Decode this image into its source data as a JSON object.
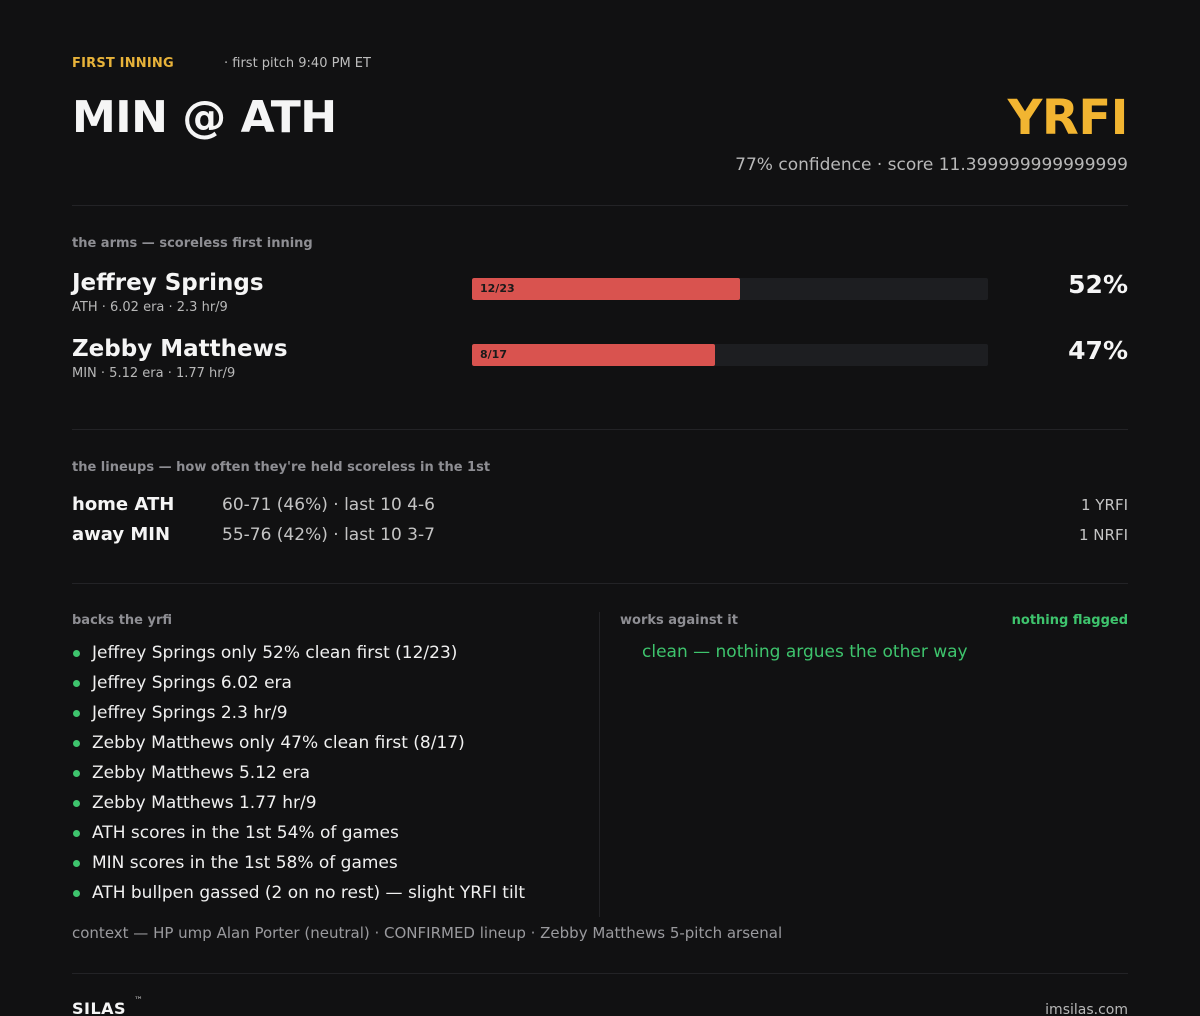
{
  "header": {
    "inning_tag": "FIRST INNING",
    "first_pitch": "· first pitch 9:40 PM ET",
    "matchup": "MIN @ ATH",
    "pick": "YRFI",
    "confidence_line": "77% confidence · score 11.399999999999999"
  },
  "arms": {
    "title": "the arms — scoreless first inning",
    "pitchers": [
      {
        "name": "Jeffrey Springs",
        "meta": "ATH · 6.02 era · 2.3 hr/9",
        "record": "12/23",
        "clean_fraction": 0.52,
        "pct_label": "52%"
      },
      {
        "name": "Zebby Matthews",
        "meta": "MIN · 5.12 era · 1.77 hr/9",
        "record": "8/17",
        "clean_fraction": 0.47,
        "pct_label": "47%"
      }
    ]
  },
  "lineups": {
    "title": "the lineups — how often they're held scoreless in the 1st",
    "rows": [
      {
        "team": "home ATH",
        "stats": "60-71 (46%) · last 10  4-6",
        "verdict": "1 YRFI"
      },
      {
        "team": "away MIN",
        "stats": "55-76 (42%) · last 10  3-7",
        "verdict": "1 NRFI"
      }
    ]
  },
  "backs": {
    "title": "backs the yrfi",
    "items": [
      "Jeffrey Springs only 52% clean first (12/23)",
      "Jeffrey Springs 6.02 era",
      "Jeffrey Springs 2.3 hr/9",
      "Zebby Matthews only 47% clean first (8/17)",
      "Zebby Matthews 5.12 era",
      "Zebby Matthews 1.77 hr/9",
      "ATH scores in the 1st 54% of games",
      "MIN scores in the 1st 58% of games",
      "ATH bullpen gassed (2 on no rest) — slight YRFI tilt"
    ]
  },
  "against": {
    "title": "works against it",
    "flag": "nothing flagged",
    "note": "clean — nothing argues the other way"
  },
  "context": "context — HP ump Alan Porter (neutral) · CONFIRMED lineup · Zebby Matthews 5-pitch arsenal",
  "footer": {
    "brand": "SILAS",
    "tm": "™",
    "site": "imsilas.com"
  },
  "colors": {
    "accent": "#f2b531",
    "bar_fill": "#d9534f",
    "positive": "#3ec46d",
    "background": "#111112"
  }
}
